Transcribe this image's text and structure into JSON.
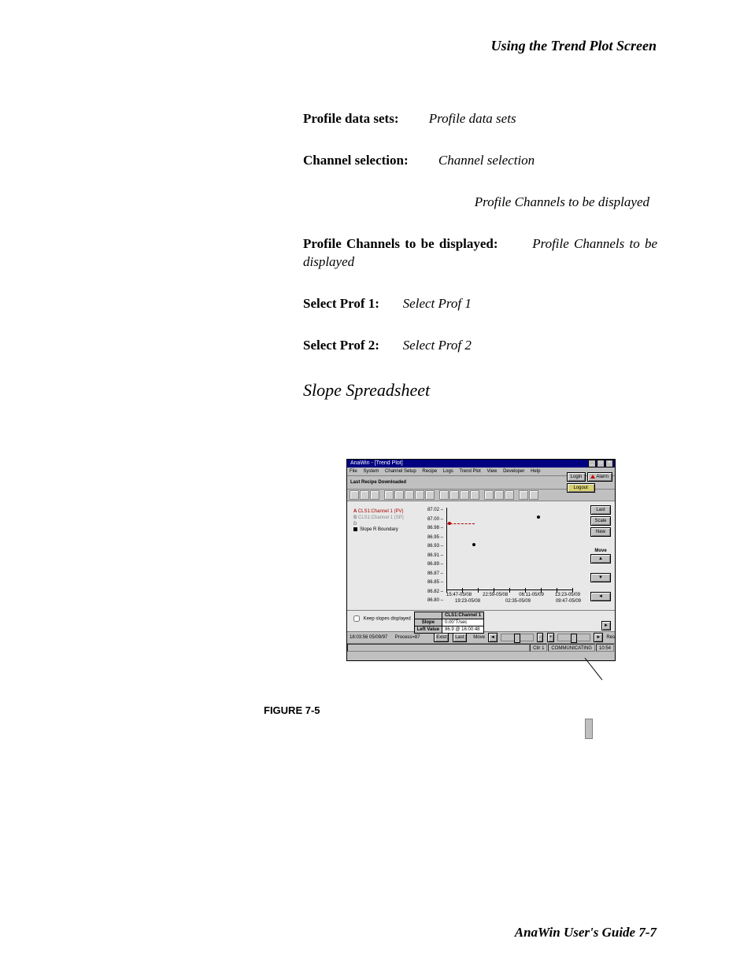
{
  "header": "Using the Trend Plot Screen",
  "defs": {
    "profile_data_sets": {
      "label": "Profile data sets:",
      "value": "Profile data sets"
    },
    "channel_selection": {
      "label": "Channel  selection:",
      "value": "Channel  selection"
    },
    "profile_channels_note": "Profile Channels to be displayed",
    "profile_channels": {
      "label": "Profile  Channels  to  be  displayed:",
      "value": "Profile  Channels  to  be displayed"
    },
    "select_prof1": {
      "label": "Select Prof 1:",
      "value": "Select Prof 1"
    },
    "select_prof2": {
      "label": "Select Prof 2:",
      "value": "Select Prof 2"
    }
  },
  "section_title": "Slope Spreadsheet",
  "screenshot": {
    "title": "AnaWin - [Trend Plot]",
    "menu": [
      "File",
      "System",
      "Channel Setup",
      "Recipe",
      "Logs",
      "Trend Plot",
      "View",
      "Developer",
      "Help"
    ],
    "recipe_label": "Last Recipe Downloaded",
    "login": "Login",
    "logout": "Logout",
    "alarm": "Alarm",
    "side_buttons": {
      "last": "Last",
      "scale": "Scale",
      "new": "New",
      "move": "Move"
    },
    "legend": {
      "a": "CLS1:Channel 1 (PV)",
      "b": "CLS1:Channel 1 (SP)",
      "slope": "Slope R Boundary"
    },
    "y_ticks": [
      "87.02",
      "87.00",
      "86.98",
      "86.95",
      "86.93",
      "86.91",
      "86.89",
      "86.87",
      "86.85",
      "86.82",
      "86.80"
    ],
    "x_ticks_top": [
      "15:47-05/08",
      "22:59-05/08",
      "06:11-05/09",
      "13:23-05/09"
    ],
    "x_ticks_bot": [
      "19:23-05/08",
      "02:35-05/09",
      "09:47-05/09"
    ],
    "keep_slopes": "Keep slopes displayed",
    "table": {
      "col_header": "CLS1:Channel 1",
      "row1_label": "Slope",
      "row1_val": "0.00˚T/sec",
      "row2_label": "Left Value",
      "row2_val": "86.9 @ 16:00:48"
    },
    "bottom": {
      "timestamp": "18:03:56 05/09/97",
      "process": "Process=87",
      "exist": "Exist",
      "last": "Last",
      "move": "Move",
      "res": "Res"
    },
    "status": {
      "ctlr": "Ctlr 1",
      "comm": "COMMUNICATING",
      "time": "10:54"
    }
  },
  "figure_caption": "FIGURE 7-5",
  "footer": "AnaWin User's Guide  7-7"
}
